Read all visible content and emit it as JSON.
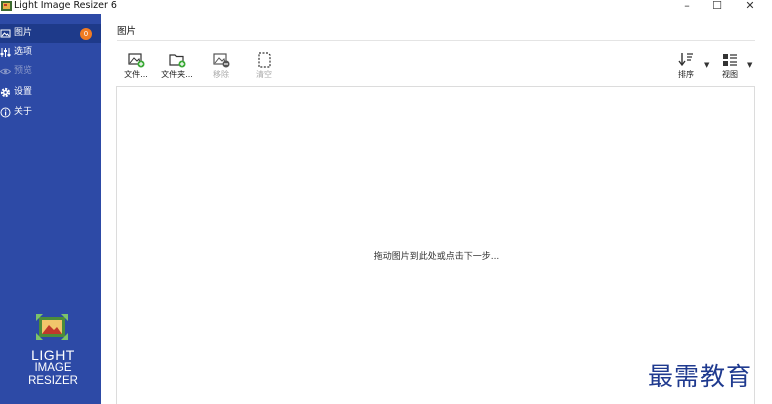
{
  "window": {
    "title": "Light Image Resizer 6",
    "controls": {
      "minimize": "–",
      "maximize": "☐",
      "close": "✕"
    }
  },
  "sidebar": {
    "items": [
      {
        "label": "图片",
        "icon": "image-icon",
        "badge": "0",
        "active": true
      },
      {
        "label": "选项",
        "icon": "sliders-icon"
      },
      {
        "label": "预览",
        "icon": "eye-icon",
        "disabled": true
      },
      {
        "label": "设置",
        "icon": "gear-icon"
      },
      {
        "label": "关于",
        "icon": "info-icon"
      }
    ],
    "logo_lines": [
      "LIGHT",
      "IMAGE",
      "RESIZER"
    ]
  },
  "content": {
    "title": "图片",
    "toolbar": {
      "file": "文件...",
      "folder": "文件夹...",
      "remove": "移除",
      "clear": "清空",
      "sort": "排序",
      "view": "视图"
    },
    "drop_hint": "拖动图片到此处或点击下一步..."
  },
  "watermark": "最需教育",
  "colors": {
    "sidebar_bg": "#2d4aa6",
    "sidebar_active": "#1e3a8a",
    "badge": "#f07b22",
    "add_green": "#3aa935"
  }
}
